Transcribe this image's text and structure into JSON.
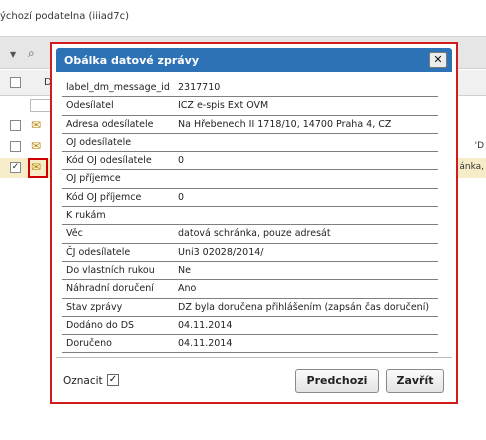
{
  "app": {
    "window_title": "ýchozí podatelna (iiiad7c)",
    "toolbar": {
      "filter_icon": "caret-down",
      "search_icon": "magnifier"
    },
    "grid": {
      "header_col": "D",
      "rows": [
        {
          "checked": "",
          "tail": ""
        },
        {
          "checked": "",
          "tail": "'D"
        },
        {
          "checked": "✓",
          "tail": "ánka,"
        }
      ]
    }
  },
  "dialog": {
    "title": "Obálka datové zprávy",
    "close_label": "✕",
    "fields": [
      {
        "label": "label_dm_message_id",
        "value": "2317710"
      },
      {
        "label": "Odesílatel",
        "value": "ICZ e-spis Ext OVM"
      },
      {
        "label": "Adresa odesílatele",
        "value": "Na Hřebenech II 1718/10, 14700 Praha 4, CZ"
      },
      {
        "label": "OJ odesílatele",
        "value": ""
      },
      {
        "label": "Kód OJ odesílatele",
        "value": "0"
      },
      {
        "label": "OJ příjemce",
        "value": ""
      },
      {
        "label": "Kód OJ příjemce",
        "value": "0"
      },
      {
        "label": "K rukám",
        "value": ""
      },
      {
        "label": "Věc",
        "value": "datová schránka, pouze adresát"
      },
      {
        "label": "ČJ odesílatele",
        "value": "Uni3 02028/2014/"
      },
      {
        "label": "Do vlastních rukou",
        "value": "Ne"
      },
      {
        "label": "Náhradní doručení",
        "value": "Ano"
      },
      {
        "label": "Stav zprávy",
        "value": "DZ byla doručena přihlášením (zapsán čas doručení)"
      },
      {
        "label": "Dodáno do DS",
        "value": "04.11.2014"
      },
      {
        "label": "Doručeno",
        "value": "04.11.2014"
      }
    ],
    "footer": {
      "oznacit_label": "Oznacit",
      "oznacit_checked": "✓",
      "prev_button": "Predchozi",
      "close_button": "Zavřít"
    }
  },
  "colors": {
    "titlebar": "#2e72b6",
    "highlight_border": "#d21c1c",
    "selected_row": "#f6edc8"
  }
}
